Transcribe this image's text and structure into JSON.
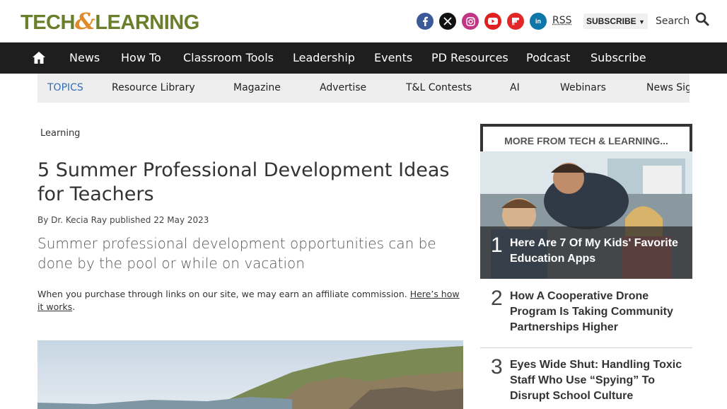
{
  "header": {
    "logo_left": "TECH",
    "logo_amp": "&",
    "logo_right": "LEARNING",
    "socials": [
      "facebook-icon",
      "x-icon",
      "instagram-icon",
      "youtube-icon",
      "flipboard-icon",
      "linkedin-icon"
    ],
    "rss_label": "RSS",
    "subscribe_label": "SUBSCRIBE",
    "search_label": "Search"
  },
  "nav": {
    "items": [
      "News",
      "How To",
      "Classroom Tools",
      "Leadership",
      "Events",
      "PD Resources",
      "Podcast",
      "Subscribe"
    ]
  },
  "topics": {
    "lead": "TOPICS",
    "items": [
      "Resource Library",
      "Magazine",
      "Advertise",
      "T&L Contests",
      "AI",
      "Webinars",
      "News Sig"
    ]
  },
  "article": {
    "breadcrumb": "Learning",
    "headline": "5 Summer Professional Development Ideas for Teachers",
    "by": "By",
    "author": "Dr. Kecia Ray",
    "published": "published",
    "date": "22 May 2023",
    "strap": "Summer professional development opportunities can be done by the pool or while on vacation",
    "affiliate_text": "When you purchase through links on our site, we may earn an affiliate commission.",
    "affiliate_link": "Here’s how it works",
    "affiliate_end": "."
  },
  "sidebar": {
    "title": "MORE FROM TECH & LEARNING...",
    "items": [
      {
        "rank": "1",
        "title": "Here Are 7 Of My Kids' Favorite Education Apps"
      },
      {
        "rank": "2",
        "title": "How A Cooperative Drone Program Is Taking Community Partnerships Higher"
      },
      {
        "rank": "3",
        "title": "Eyes Wide Shut: Handling Toxic Staff Who Use “Spying” To Disrupt School Culture"
      }
    ]
  },
  "colors": {
    "nav_bg": "#1e1e1e",
    "topics_accent": "#2f6db5",
    "facebook": "#3b5998",
    "x": "#111111",
    "instagram": "#c13584",
    "youtube": "#e02020",
    "flipboard": "#e12828",
    "linkedin": "#0e76a8"
  }
}
